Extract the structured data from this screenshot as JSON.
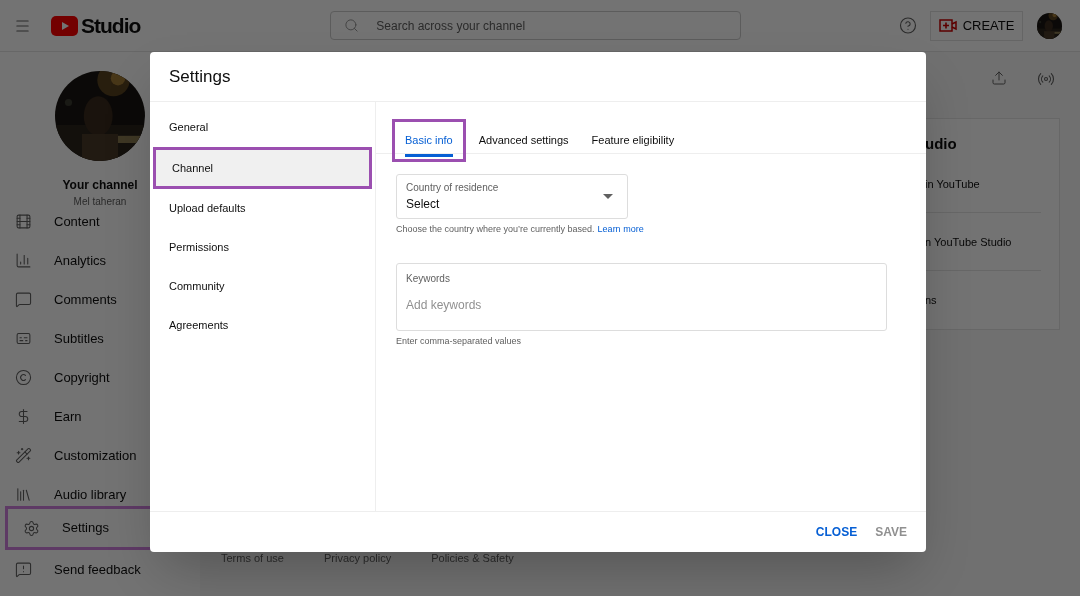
{
  "header": {
    "logo_text": "Studio",
    "search_placeholder": "Search across your channel",
    "create_button": "CREATE"
  },
  "channel": {
    "title": "Your channel",
    "name": "Mel taheran"
  },
  "sidebar": {
    "items": [
      {
        "label": "Content",
        "highlighted": false
      },
      {
        "label": "Analytics",
        "highlighted": false
      },
      {
        "label": "Comments",
        "highlighted": false
      },
      {
        "label": "Subtitles",
        "highlighted": false
      },
      {
        "label": "Copyright",
        "highlighted": false
      },
      {
        "label": "Earn",
        "highlighted": false
      },
      {
        "label": "Customization",
        "highlighted": false
      },
      {
        "label": "Audio library",
        "highlighted": false
      }
    ],
    "bottom_items": [
      {
        "label": "Settings",
        "highlighted": true
      },
      {
        "label": "Send feedback",
        "highlighted": false
      }
    ]
  },
  "background_card": {
    "heading": "udio",
    "lines": [
      "in YouTube",
      "n YouTube Studio",
      "ns"
    ]
  },
  "footer_links": [
    "Terms of use",
    "Privacy policy",
    "Policies & Safety"
  ],
  "dialog": {
    "title": "Settings",
    "nav": [
      {
        "label": "General",
        "selected": false,
        "highlighted": false
      },
      {
        "label": "Channel",
        "selected": true,
        "highlighted": true
      },
      {
        "label": "Upload defaults",
        "selected": false,
        "highlighted": false
      },
      {
        "label": "Permissions",
        "selected": false,
        "highlighted": false
      },
      {
        "label": "Community",
        "selected": false,
        "highlighted": false
      },
      {
        "label": "Agreements",
        "selected": false,
        "highlighted": false
      }
    ],
    "tabs": [
      {
        "label": "Basic info",
        "selected": true,
        "highlighted": true
      },
      {
        "label": "Advanced settings",
        "selected": false,
        "highlighted": false
      },
      {
        "label": "Feature eligibility",
        "selected": false,
        "highlighted": false
      }
    ],
    "country_field": {
      "label": "Country of residence",
      "value": "Select",
      "helper": "Choose the country where you’re currently based.",
      "helper_link": "Learn more"
    },
    "keywords_field": {
      "label": "Keywords",
      "placeholder": "Add keywords",
      "helper": "Enter comma-separated values"
    },
    "buttons": [
      {
        "label": "CLOSE",
        "disabled": false
      },
      {
        "label": "SAVE",
        "disabled": true
      }
    ]
  }
}
